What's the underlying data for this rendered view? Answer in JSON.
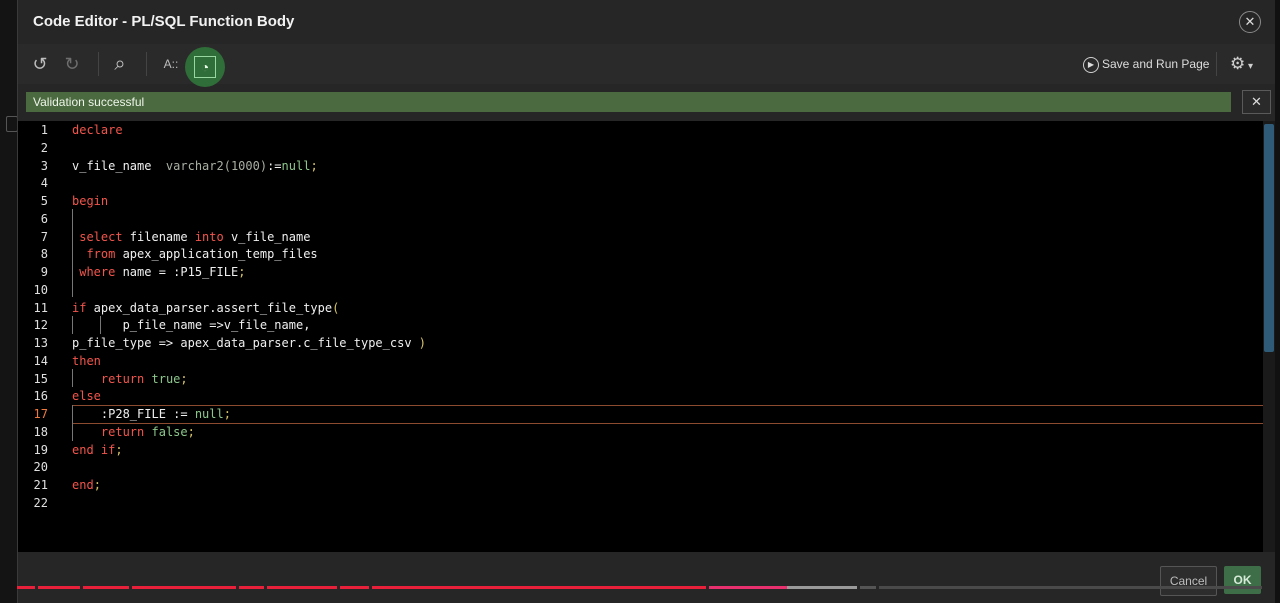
{
  "dialog": {
    "title": "Code Editor - PL/SQL Function Body",
    "close_glyph": "✕"
  },
  "toolbar": {
    "undo_icon": "↺",
    "redo_icon": "↻",
    "search_icon": "⌕",
    "autocomplete_label": "A::",
    "validate_icon": "◔",
    "save_run_label": "Save and Run Page",
    "play_icon": "▶",
    "settings_icon": "⚙"
  },
  "banner": {
    "message": "Validation successful",
    "close_glyph": "✕"
  },
  "editor": {
    "lines": [
      {
        "n": "1",
        "tokens": [
          {
            "t": "declare",
            "c": "kw"
          }
        ]
      },
      {
        "n": "2",
        "tokens": []
      },
      {
        "n": "3",
        "tokens": [
          {
            "t": "v_file_name  ",
            "c": "tx"
          },
          {
            "t": "varchar2(1000)",
            "c": "ty"
          },
          {
            "t": ":=",
            "c": "tx"
          },
          {
            "t": "null",
            "c": "nu"
          },
          {
            "t": ";",
            "c": "op"
          }
        ]
      },
      {
        "n": "4",
        "tokens": []
      },
      {
        "n": "5",
        "tokens": [
          {
            "t": "begin",
            "c": "kw"
          }
        ]
      },
      {
        "n": "6",
        "tokens": []
      },
      {
        "n": "7",
        "tokens": [
          {
            "t": " select",
            "c": "kw"
          },
          {
            "t": " filename ",
            "c": "tx"
          },
          {
            "t": "into",
            "c": "kw"
          },
          {
            "t": " v_file_name",
            "c": "tx"
          }
        ]
      },
      {
        "n": "8",
        "tokens": [
          {
            "t": "  from",
            "c": "kw"
          },
          {
            "t": " apex_application_temp_files",
            "c": "tx"
          }
        ]
      },
      {
        "n": "9",
        "tokens": [
          {
            "t": " where",
            "c": "kw"
          },
          {
            "t": " name = :P15_FILE",
            "c": "tx"
          },
          {
            "t": ";",
            "c": "op"
          }
        ]
      },
      {
        "n": "10",
        "tokens": []
      },
      {
        "n": "11",
        "tokens": [
          {
            "t": "if",
            "c": "kw"
          },
          {
            "t": " apex_data_parser.assert_file_type",
            "c": "tx"
          },
          {
            "t": "(",
            "c": "op"
          }
        ]
      },
      {
        "n": "12",
        "tokens": [
          {
            "t": "       p_file_name =>v_file_name,",
            "c": "tx"
          }
        ]
      },
      {
        "n": "13",
        "tokens": [
          {
            "t": "p_file_type => apex_data_parser.c_file_type_csv ",
            "c": "tx"
          },
          {
            "t": ")",
            "c": "op"
          }
        ]
      },
      {
        "n": "14",
        "tokens": [
          {
            "t": "then",
            "c": "kw"
          }
        ]
      },
      {
        "n": "15",
        "tokens": [
          {
            "t": "    ",
            "c": "tx"
          },
          {
            "t": "return",
            "c": "kw"
          },
          {
            "t": " true",
            "c": "nu"
          },
          {
            "t": ";",
            "c": "op"
          }
        ]
      },
      {
        "n": "16",
        "tokens": [
          {
            "t": "else",
            "c": "kw"
          }
        ]
      },
      {
        "n": "17",
        "tokens": [
          {
            "t": "    :P28_FILE := ",
            "c": "tx"
          },
          {
            "t": "null",
            "c": "nu"
          },
          {
            "t": ";",
            "c": "op"
          }
        ]
      },
      {
        "n": "18",
        "tokens": [
          {
            "t": "    ",
            "c": "tx"
          },
          {
            "t": "return",
            "c": "kw"
          },
          {
            "t": " false",
            "c": "nu"
          },
          {
            "t": ";",
            "c": "op"
          }
        ]
      },
      {
        "n": "19",
        "tokens": [
          {
            "t": "end",
            "c": "kw"
          },
          {
            "t": " if",
            "c": "kw"
          },
          {
            "t": ";",
            "c": "op"
          }
        ]
      },
      {
        "n": "20",
        "tokens": []
      },
      {
        "n": "21",
        "tokens": [
          {
            "t": "end",
            "c": "kw"
          },
          {
            "t": ";",
            "c": "op"
          }
        ]
      },
      {
        "n": "22",
        "tokens": []
      }
    ],
    "active_line": "17"
  },
  "footer": {
    "cancel_label": "Cancel",
    "ok_label": "OK"
  },
  "colors": {
    "accent_green": "#2f6d39",
    "banner_green": "#4b6a3f",
    "keyword_red": "#f2554c",
    "progress_red": "#e8203a"
  }
}
